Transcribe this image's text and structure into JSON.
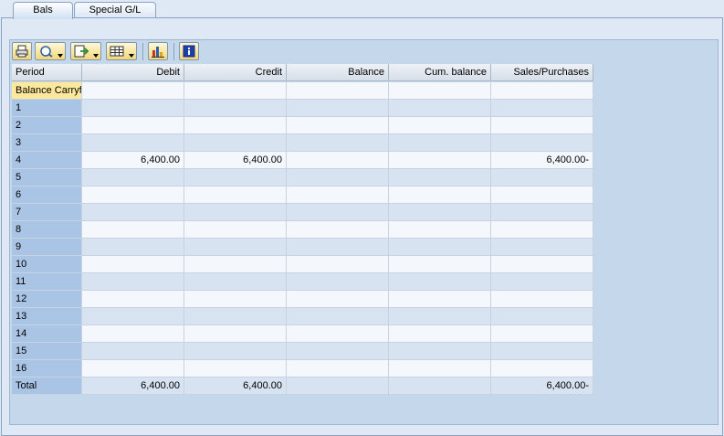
{
  "tabs": [
    {
      "label": "Bals",
      "active": true
    },
    {
      "label": "Special G/L",
      "active": false
    }
  ],
  "toolbar": {
    "buttons": [
      "print-icon",
      "details-icon",
      "export-icon",
      "layout-icon",
      "graphic-icon",
      "info-icon"
    ]
  },
  "table": {
    "columns": [
      "Period",
      "Debit",
      "Credit",
      "Balance",
      "Cum. balance",
      "Sales/Purchases"
    ],
    "rows": [
      [
        "Balance Carryforward",
        "",
        "",
        "",
        "",
        ""
      ],
      [
        "1",
        "",
        "",
        "",
        "",
        ""
      ],
      [
        "2",
        "",
        "",
        "",
        "",
        ""
      ],
      [
        "3",
        "",
        "",
        "",
        "",
        ""
      ],
      [
        "4",
        "6,400.00",
        "6,400.00",
        "",
        "",
        "6,400.00-"
      ],
      [
        "5",
        "",
        "",
        "",
        "",
        ""
      ],
      [
        "6",
        "",
        "",
        "",
        "",
        ""
      ],
      [
        "7",
        "",
        "",
        "",
        "",
        ""
      ],
      [
        "8",
        "",
        "",
        "",
        "",
        ""
      ],
      [
        "9",
        "",
        "",
        "",
        "",
        ""
      ],
      [
        "10",
        "",
        "",
        "",
        "",
        ""
      ],
      [
        "11",
        "",
        "",
        "",
        "",
        ""
      ],
      [
        "12",
        "",
        "",
        "",
        "",
        ""
      ],
      [
        "13",
        "",
        "",
        "",
        "",
        ""
      ],
      [
        "14",
        "",
        "",
        "",
        "",
        ""
      ],
      [
        "15",
        "",
        "",
        "",
        "",
        ""
      ],
      [
        "16",
        "",
        "",
        "",
        "",
        ""
      ],
      [
        "Total",
        "6,400.00",
        "6,400.00",
        "",
        "",
        "6,400.00-"
      ]
    ]
  }
}
